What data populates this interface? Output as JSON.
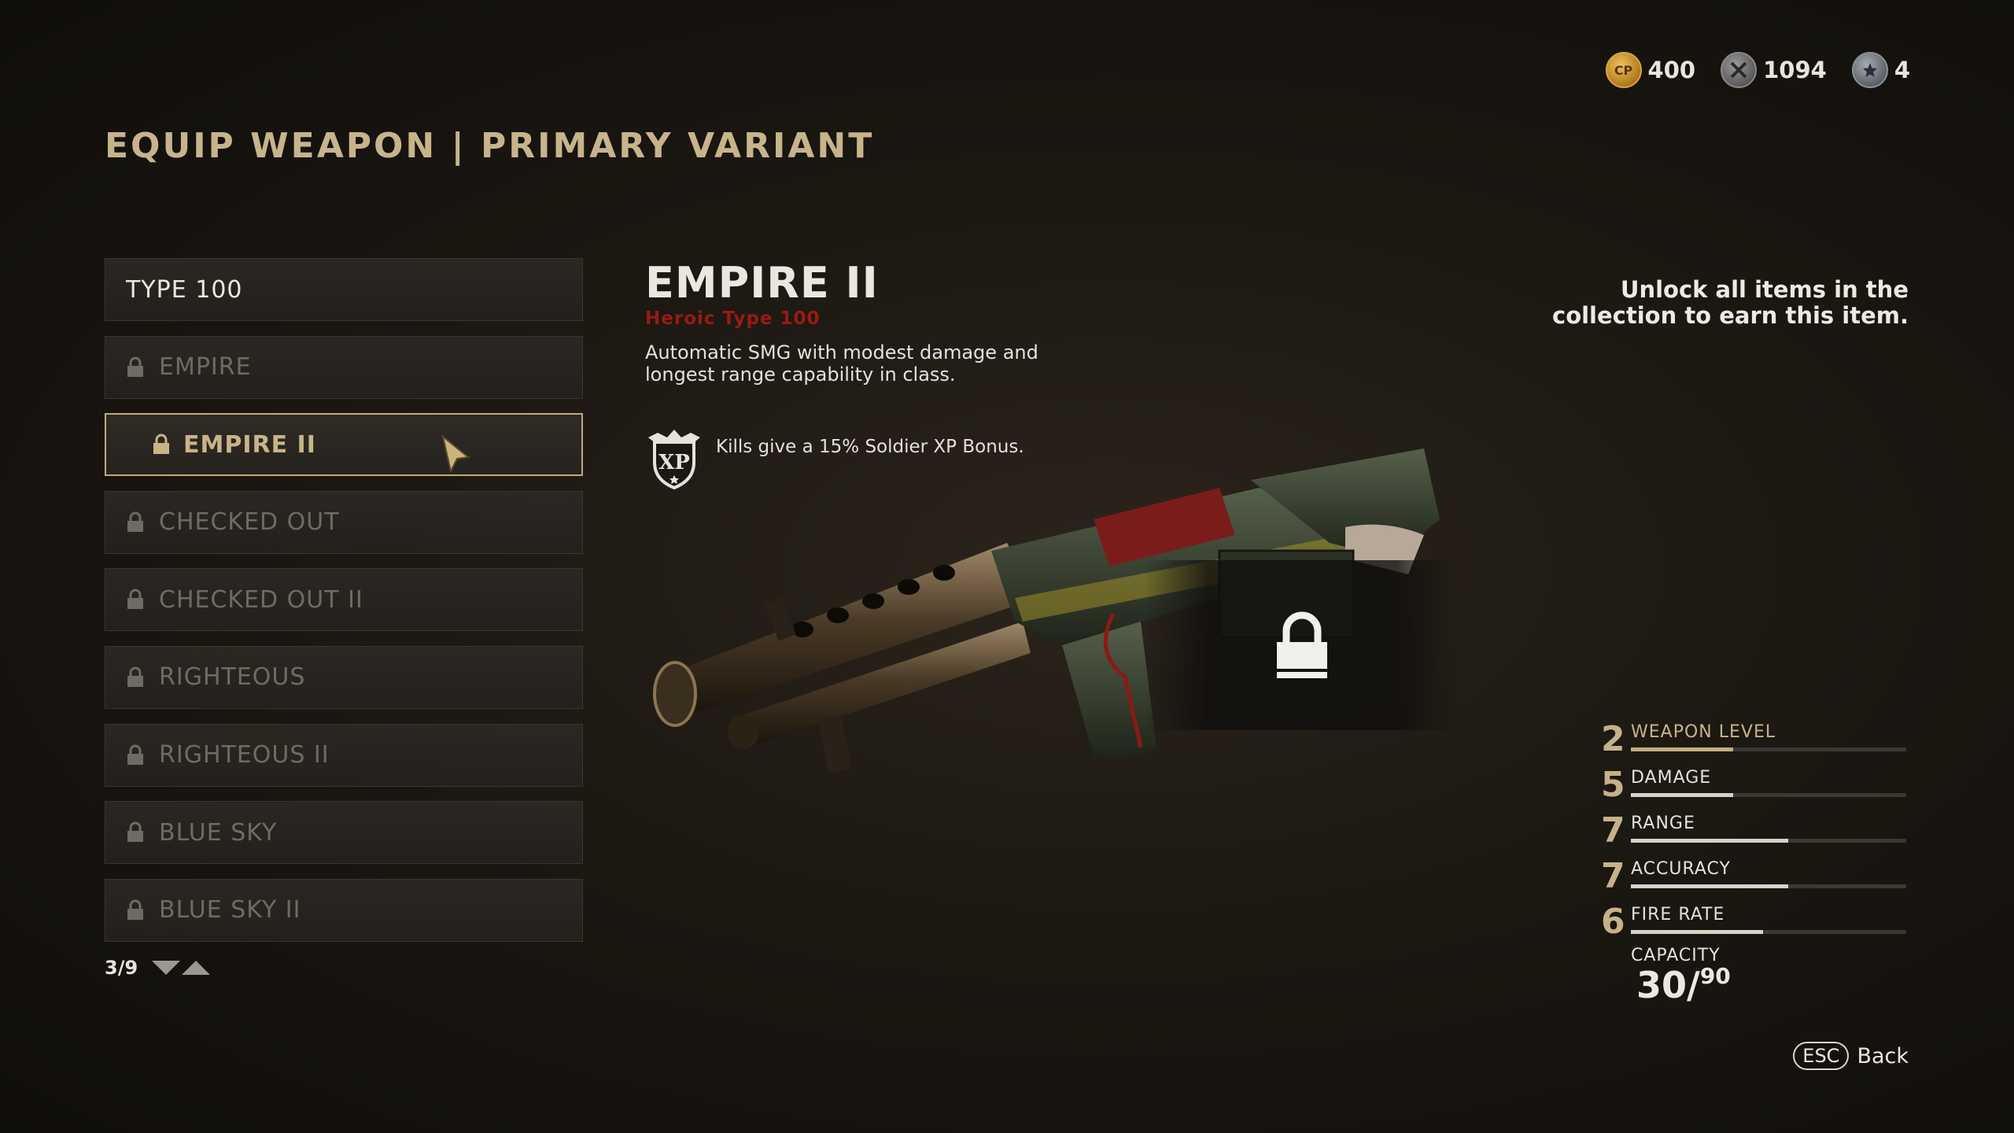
{
  "title": "EQUIP WEAPON | PRIMARY VARIANT",
  "currency": [
    {
      "icon": "cp-coin-icon",
      "badge": "CP",
      "value": "400"
    },
    {
      "icon": "armory-parts-icon",
      "value": "1094"
    },
    {
      "icon": "supply-drop-icon",
      "value": "4"
    }
  ],
  "variants": [
    {
      "label": "TYPE 100",
      "locked": false
    },
    {
      "label": "EMPIRE",
      "locked": true
    },
    {
      "label": "EMPIRE II",
      "locked": true,
      "selected": true
    },
    {
      "label": "CHECKED OUT",
      "locked": true
    },
    {
      "label": "CHECKED OUT II",
      "locked": true
    },
    {
      "label": "RIGHTEOUS",
      "locked": true
    },
    {
      "label": "RIGHTEOUS II",
      "locked": true
    },
    {
      "label": "BLUE SKY",
      "locked": true
    },
    {
      "label": "BLUE SKY II",
      "locked": true
    }
  ],
  "pager": "3/9",
  "weapon": {
    "name": "EMPIRE II",
    "rarity": "Heroic Type 100",
    "description": "Automatic SMG with modest damage and longest range capability in class.",
    "bonus_badge": "XP",
    "bonus": "Kills give a 15% Soldier XP Bonus."
  },
  "unlock_note": "Unlock all items in the collection to earn this item.",
  "stats": [
    {
      "value": "2",
      "label": "WEAPON LEVEL",
      "fill": 0.37,
      "level": true
    },
    {
      "value": "5",
      "label": "DAMAGE",
      "fill": 0.37
    },
    {
      "value": "7",
      "label": "RANGE",
      "fill": 0.57
    },
    {
      "value": "7",
      "label": "ACCURACY",
      "fill": 0.57
    },
    {
      "value": "6",
      "label": "FIRE RATE",
      "fill": 0.48
    }
  ],
  "capacity": {
    "label": "CAPACITY",
    "mag": "30/",
    "reserve": "90"
  },
  "back": {
    "key": "ESC",
    "label": "Back"
  },
  "colors": {
    "accent": "#c7b48b",
    "rarity": "#9a1a14"
  }
}
